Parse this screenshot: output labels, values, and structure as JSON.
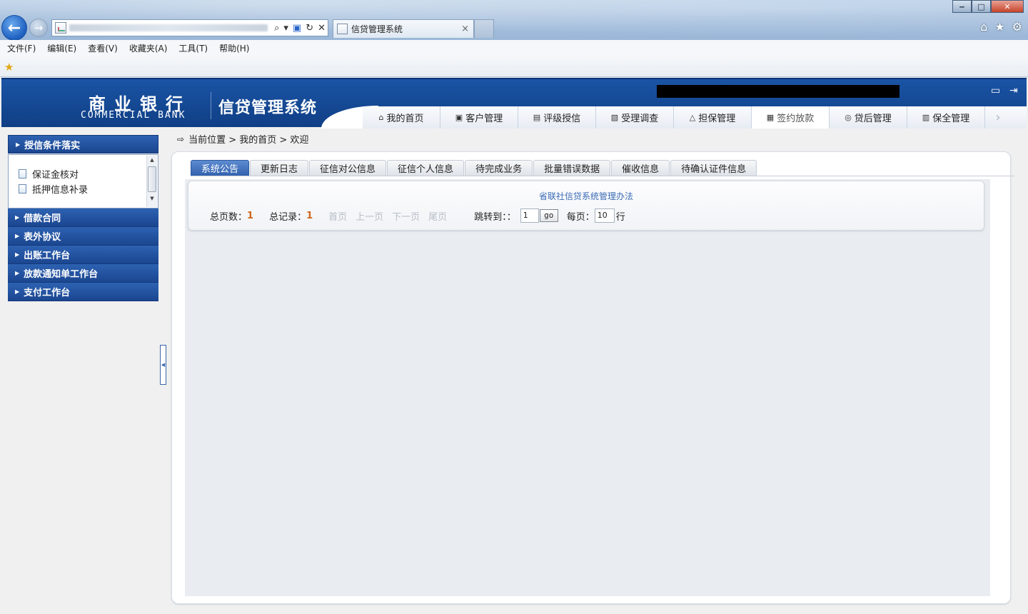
{
  "browser": {
    "tab_title": "信贷管理系统",
    "tab_close": "×",
    "menu": [
      "文件(F)",
      "编辑(E)",
      "查看(V)",
      "收藏夹(A)",
      "工具(T)",
      "帮助(H)"
    ],
    "window_controls": {
      "minimize": "‒",
      "maximize": "□",
      "close": "✕"
    },
    "icons": [
      "back-arrow-icon",
      "forward-arrow-icon",
      "search-icon",
      "refresh-icon",
      "stop-icon",
      "home-icon",
      "favorites-star-icon",
      "gear-icon"
    ]
  },
  "header": {
    "logo_cn": "商业银行",
    "logo_en": "COMMERCIAL BANK",
    "system_name": "信贷管理系统",
    "nav": [
      {
        "label": "我的首页",
        "icon": "home-icon",
        "glyph": "⌂",
        "active": false
      },
      {
        "label": "客户管理",
        "icon": "customer-icon",
        "glyph": "▣",
        "active": false
      },
      {
        "label": "评级授信",
        "icon": "rating-icon",
        "glyph": "▤",
        "active": false
      },
      {
        "label": "受理调查",
        "icon": "survey-icon",
        "glyph": "▧",
        "active": false
      },
      {
        "label": "担保管理",
        "icon": "guarantee-icon",
        "glyph": "△",
        "active": false
      },
      {
        "label": "签约放款",
        "icon": "contract-icon",
        "glyph": "▦",
        "active": true
      },
      {
        "label": "贷后管理",
        "icon": "post-loan-icon",
        "glyph": "◎",
        "active": false
      },
      {
        "label": "保全管理",
        "icon": "preservation-icon",
        "glyph": "▥",
        "active": false
      }
    ]
  },
  "sidebar": {
    "open_section": {
      "label": "授信条件落实",
      "items": [
        "保证金核对",
        "抵押信息补录"
      ]
    },
    "sections": [
      "借款合同",
      "表外协议",
      "出账工作台",
      "放款通知单工作台",
      "支付工作台"
    ]
  },
  "breadcrumb": "当前位置 > 我的首页 > 欢迎",
  "main": {
    "tabs": [
      {
        "label": "系统公告",
        "active": true
      },
      {
        "label": "更新日志",
        "active": false
      },
      {
        "label": "征信对公信息",
        "active": false
      },
      {
        "label": "征信个人信息",
        "active": false
      },
      {
        "label": "待完成业务",
        "active": false
      },
      {
        "label": "批量错误数据",
        "active": false
      },
      {
        "label": "催收信息",
        "active": false
      },
      {
        "label": "待确认证件信息",
        "active": false
      }
    ],
    "notice_title": "省联社信贷系统管理办法",
    "pager": {
      "total_pages_label": "总页数：",
      "total_pages": "1",
      "total_records_label": "总记录：",
      "total_records": "1",
      "first": "首页",
      "prev": "上一页",
      "next": "下一页",
      "last": "尾页",
      "jump_label": "跳转到：：",
      "jump_value": "1",
      "go": "go",
      "per_page_label": "每页：",
      "per_page": "10",
      "rows_suffix": "行"
    }
  },
  "colors": {
    "header_blue": "#1a54a5",
    "sidebar_blue": "#1b4690",
    "active_tab": "#3262ae",
    "pager_number": "#d0641b",
    "notice_link": "#3a6bb5"
  }
}
